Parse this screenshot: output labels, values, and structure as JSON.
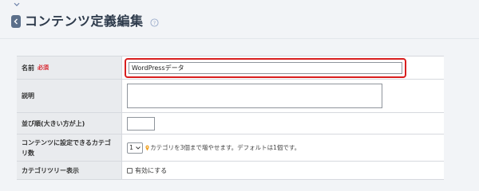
{
  "header": {
    "title": "コンテンツ定義編集",
    "back_icon": "chevron-left-icon",
    "help_icon": "question-circle-icon"
  },
  "form": {
    "name": {
      "label": "名前",
      "required_badge": "必須",
      "value": "WordPressデータ"
    },
    "description": {
      "label": "説明",
      "value": ""
    },
    "sort_order": {
      "label": "並び順(大きい方が上)",
      "value": ""
    },
    "category_count": {
      "label": "コンテンツに設定できるカテゴリ数",
      "selected": "1",
      "hint": "カテゴリを3個まで増やせます。デフォルトは1個です。"
    },
    "category_tree": {
      "label": "カテゴリツリー表示",
      "checkbox_label": "有効にする",
      "checked": false
    }
  },
  "colors": {
    "highlight": "#d81e1e",
    "required": "#d8262f",
    "back_button": "#5b6f8a",
    "label_bg": "#e9ebee",
    "pin": "#f0a020"
  }
}
